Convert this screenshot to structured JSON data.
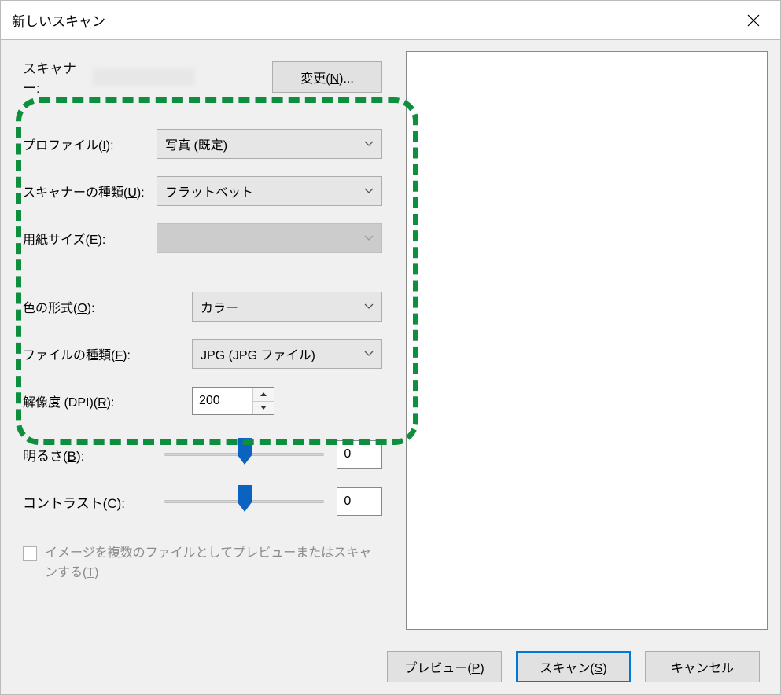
{
  "title": "新しいスキャン",
  "scanner": {
    "label": "スキャナー:",
    "change_label_pre": "変更(",
    "change_hotkey": "N",
    "change_label_post": ")..."
  },
  "profile": {
    "label_pre": "プロファイル(",
    "hotkey": "I",
    "label_post": "):",
    "value": "写真 (既定)"
  },
  "scannerType": {
    "label_pre": "スキャナーの種類(",
    "hotkey": "U",
    "label_post": "):",
    "value": "フラットベット"
  },
  "paperSize": {
    "label_pre": "用紙サイズ(",
    "hotkey": "E",
    "label_post": "):",
    "value": ""
  },
  "colorFormat": {
    "label_pre": "色の形式(",
    "hotkey": "O",
    "label_post": "):",
    "value": "カラー"
  },
  "fileType": {
    "label_pre": "ファイルの種類(",
    "hotkey": "F",
    "label_post": "):",
    "value": "JPG (JPG ファイル)"
  },
  "resolution": {
    "label_pre": "解像度 (DPI)(",
    "hotkey": "R",
    "label_post": "):",
    "value": "200"
  },
  "brightness": {
    "label_pre": "明るさ(",
    "hotkey": "B",
    "label_post": "):",
    "value": "0"
  },
  "contrast": {
    "label_pre": "コントラスト(",
    "hotkey": "C",
    "label_post": "):",
    "value": "0"
  },
  "multiFile": {
    "text_pre": "イメージを複数のファイルとしてプレビューまたはスキャンする(",
    "hotkey": "T",
    "text_post": ")"
  },
  "buttons": {
    "preview_pre": "プレビュー(",
    "preview_hotkey": "P",
    "preview_post": ")",
    "scan_pre": "スキャン(",
    "scan_hotkey": "S",
    "scan_post": ")",
    "cancel": "キャンセル"
  }
}
